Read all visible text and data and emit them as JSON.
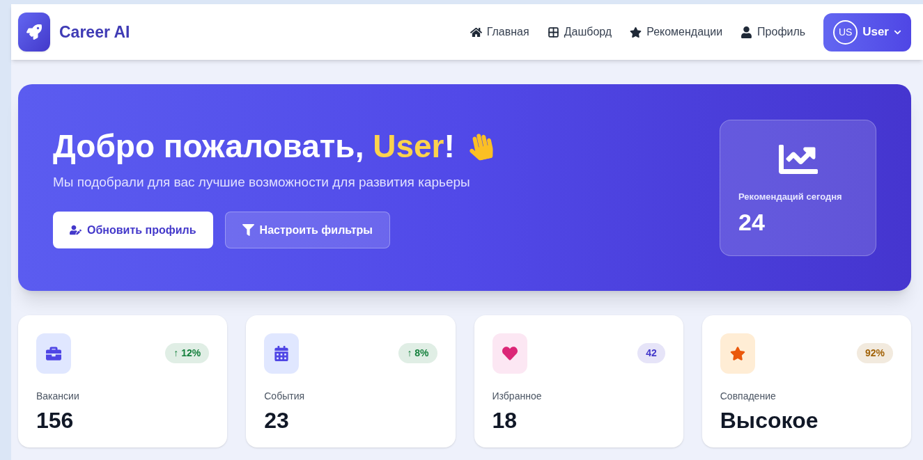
{
  "brand": {
    "name": "Career AI"
  },
  "nav": [
    {
      "kind": "home",
      "label": "Главная"
    },
    {
      "kind": "grid",
      "label": "Дашборд"
    },
    {
      "kind": "star",
      "label": "Рекомендации"
    },
    {
      "kind": "user",
      "label": "Профиль"
    }
  ],
  "user_menu": {
    "initials": "US",
    "name": "User"
  },
  "hero": {
    "title_prefix": "Добро пожаловать, ",
    "title_name": "User",
    "title_suffix": "!",
    "subtitle": "Мы подобрали для вас лучшие возможности для развития карьеры",
    "buttons": [
      {
        "kind": "primary",
        "label": "Обновить профиль"
      },
      {
        "kind": "secondary",
        "label": "Настроить фильтры"
      }
    ],
    "today": {
      "label": "Рекомендаций сегодня",
      "value": "24"
    }
  },
  "stats": [
    {
      "kind": "briefcase",
      "label": "Вакансии",
      "value": "156",
      "badge": {
        "text": "↑ 12%",
        "color": "#15803d"
      }
    },
    {
      "kind": "calendar",
      "label": "События",
      "value": "23",
      "badge": {
        "text": "↑ 8%",
        "color": "#15803d"
      }
    },
    {
      "kind": "heart",
      "label": "Избранное",
      "value": "18",
      "badge": {
        "text": "42",
        "color": "#4338ca"
      }
    },
    {
      "kind": "star",
      "label": "Совпадение",
      "value": "Высокое",
      "badge": {
        "text": "92%",
        "color": "#a16207"
      }
    }
  ]
}
